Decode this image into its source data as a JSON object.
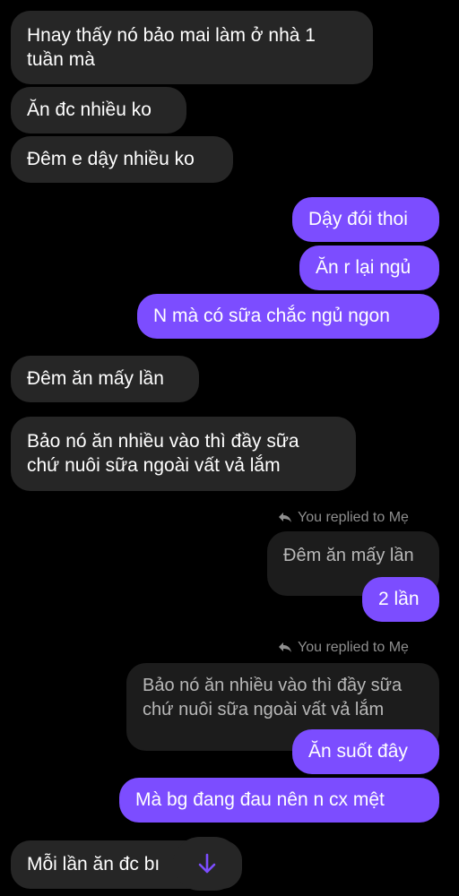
{
  "messages": {
    "m1": "Hnay thấy nó bảo mai làm ở nhà 1",
    "m1b": "tuần mà",
    "m2": "Ăn đc nhiều ko",
    "m3": "Đêm e dậy nhiều ko",
    "m4": "Dậy đói thoi",
    "m5": "Ăn r lại ngủ",
    "m6": "N mà có sữa chắc ngủ ngon",
    "m7": "Đêm ăn mấy lần",
    "m8a": "Bảo nó ăn nhiều vào thì đầy sữa",
    "m8b": "chứ nuôi sữa ngoài vất vả lắm",
    "m9": "2 lần",
    "m10": "Ăn suốt đây",
    "m11": "Mà bg đang đau nên n cx mệt",
    "m12": "Mỗi lần ăn đc bı"
  },
  "replies": {
    "r1_label": "You replied to Mẹ",
    "r1_quote": "Đêm ăn mấy lần",
    "r2_label": "You replied to Mẹ",
    "r2_quote_a": "Bảo nó ăn nhiều vào thì đầy sữa",
    "r2_quote_b": "chứ nuôi sữa ngoài vất vả lắm"
  },
  "icons": {
    "reply": "reply-arrow-icon",
    "scroll": "arrow-down-icon"
  },
  "colors": {
    "background": "#000000",
    "incoming": "#262626",
    "outgoing": "#7c4dff",
    "quote": "#1c1c1c",
    "accent": "#7c4dff"
  }
}
